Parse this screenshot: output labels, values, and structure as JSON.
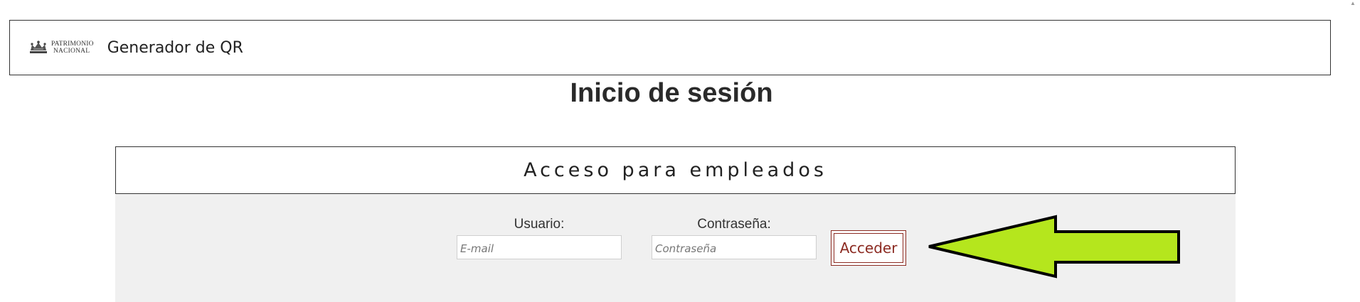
{
  "header": {
    "logo_line1": "PATRIMONIO",
    "logo_line2": "NACIONAL",
    "logo_icon": "crown-icon",
    "app_title": "Generador de QR"
  },
  "main": {
    "page_title": "Inicio de sesión"
  },
  "login_card": {
    "title": "Acceso para empleados",
    "username": {
      "label": "Usuario:",
      "placeholder": "E-mail",
      "value": ""
    },
    "password": {
      "label": "Contraseña:",
      "placeholder": "Contraseña",
      "value": ""
    },
    "submit_label": "Acceder"
  },
  "annotation": {
    "icon": "arrow-left-icon",
    "color": "#b5e61d"
  },
  "colors": {
    "button_accent": "#8b2a21",
    "panel_background": "#f0f0f0"
  }
}
